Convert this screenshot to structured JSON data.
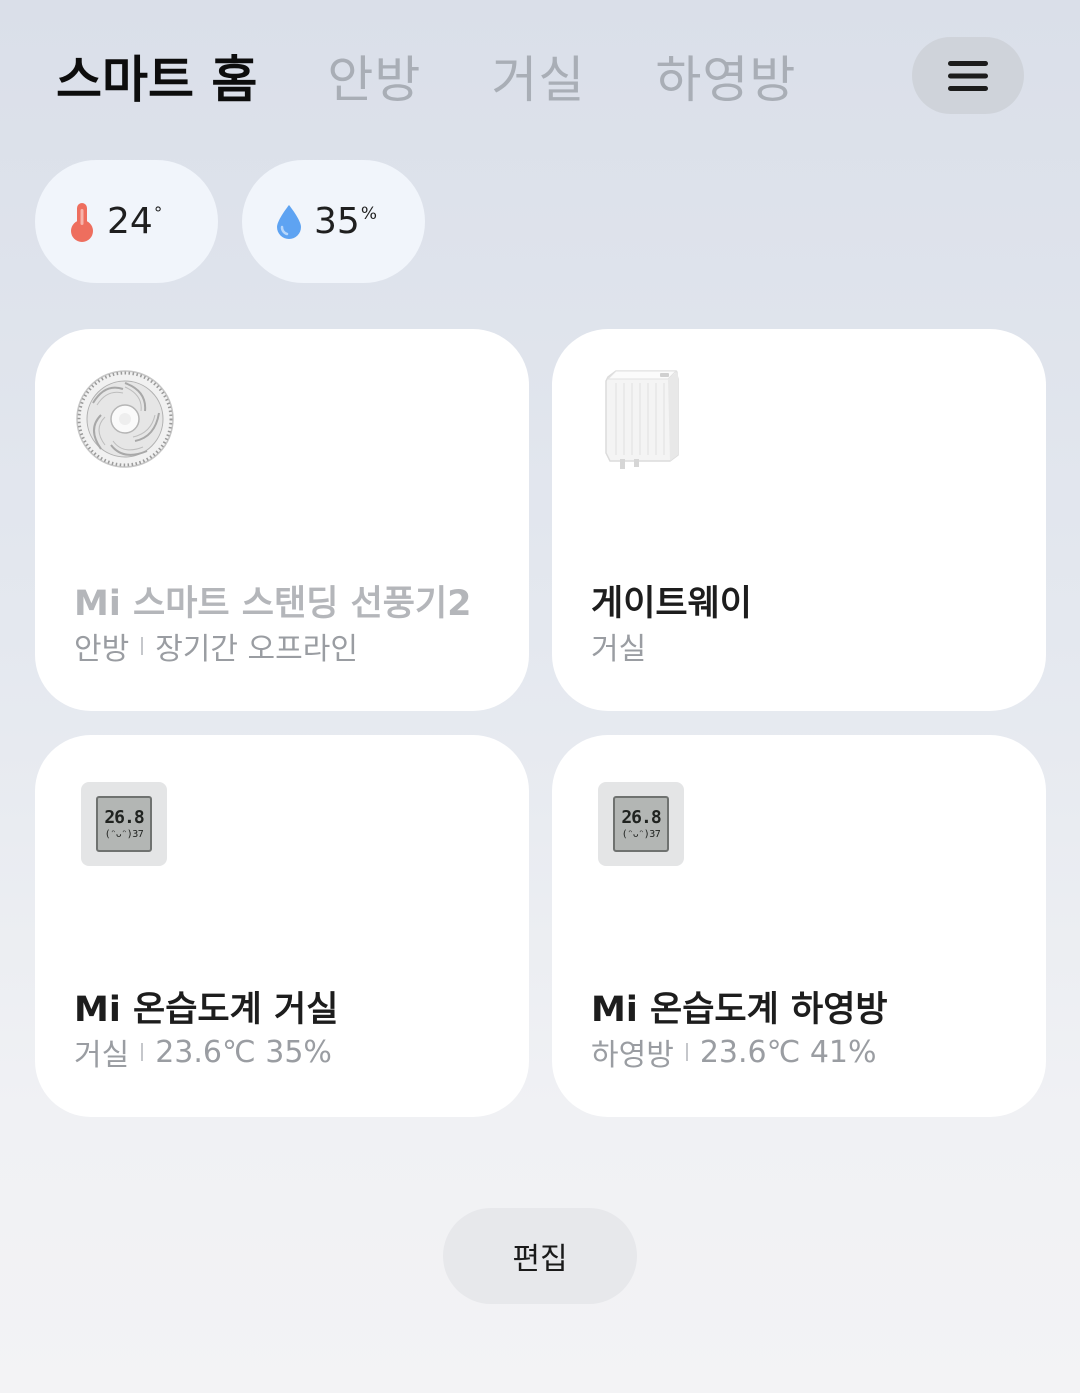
{
  "header": {
    "tabs": [
      {
        "label": "스마트 홈",
        "active": true
      },
      {
        "label": "안방",
        "active": false
      },
      {
        "label": "거실",
        "active": false
      },
      {
        "label": "하영방",
        "active": false
      }
    ],
    "menu_icon": "hamburger-menu-icon"
  },
  "environment": {
    "temperature": {
      "value": "24",
      "unit": "°",
      "icon": "thermometer-icon",
      "color": "#ee6e5e"
    },
    "humidity": {
      "value": "35",
      "unit": "%",
      "icon": "water-drop-icon",
      "color": "#5ea3f2"
    }
  },
  "devices": [
    {
      "name": "Mi 스마트 스탠딩 선풍기2",
      "room": "안방",
      "status": "장기간 오프라인",
      "offline": true,
      "icon": "standing-fan-icon"
    },
    {
      "name": "게이트웨이",
      "room": "거실",
      "status": "",
      "offline": false,
      "icon": "gateway-plug-icon"
    },
    {
      "name": "Mi 온습도계 거실",
      "room": "거실",
      "status": "23.6℃ 35%",
      "offline": false,
      "icon": "hygrometer-icon",
      "lcd_main": "26.8",
      "lcd_sub": "(ᵔᴗᵔ)37"
    },
    {
      "name": "Mi 온습도계 하영방",
      "room": "하영방",
      "status": "23.6℃ 41%",
      "offline": false,
      "icon": "hygrometer-icon",
      "lcd_main": "26.8",
      "lcd_sub": "(ᵔᴗᵔ)37"
    }
  ],
  "footer": {
    "edit_label": "편집"
  }
}
